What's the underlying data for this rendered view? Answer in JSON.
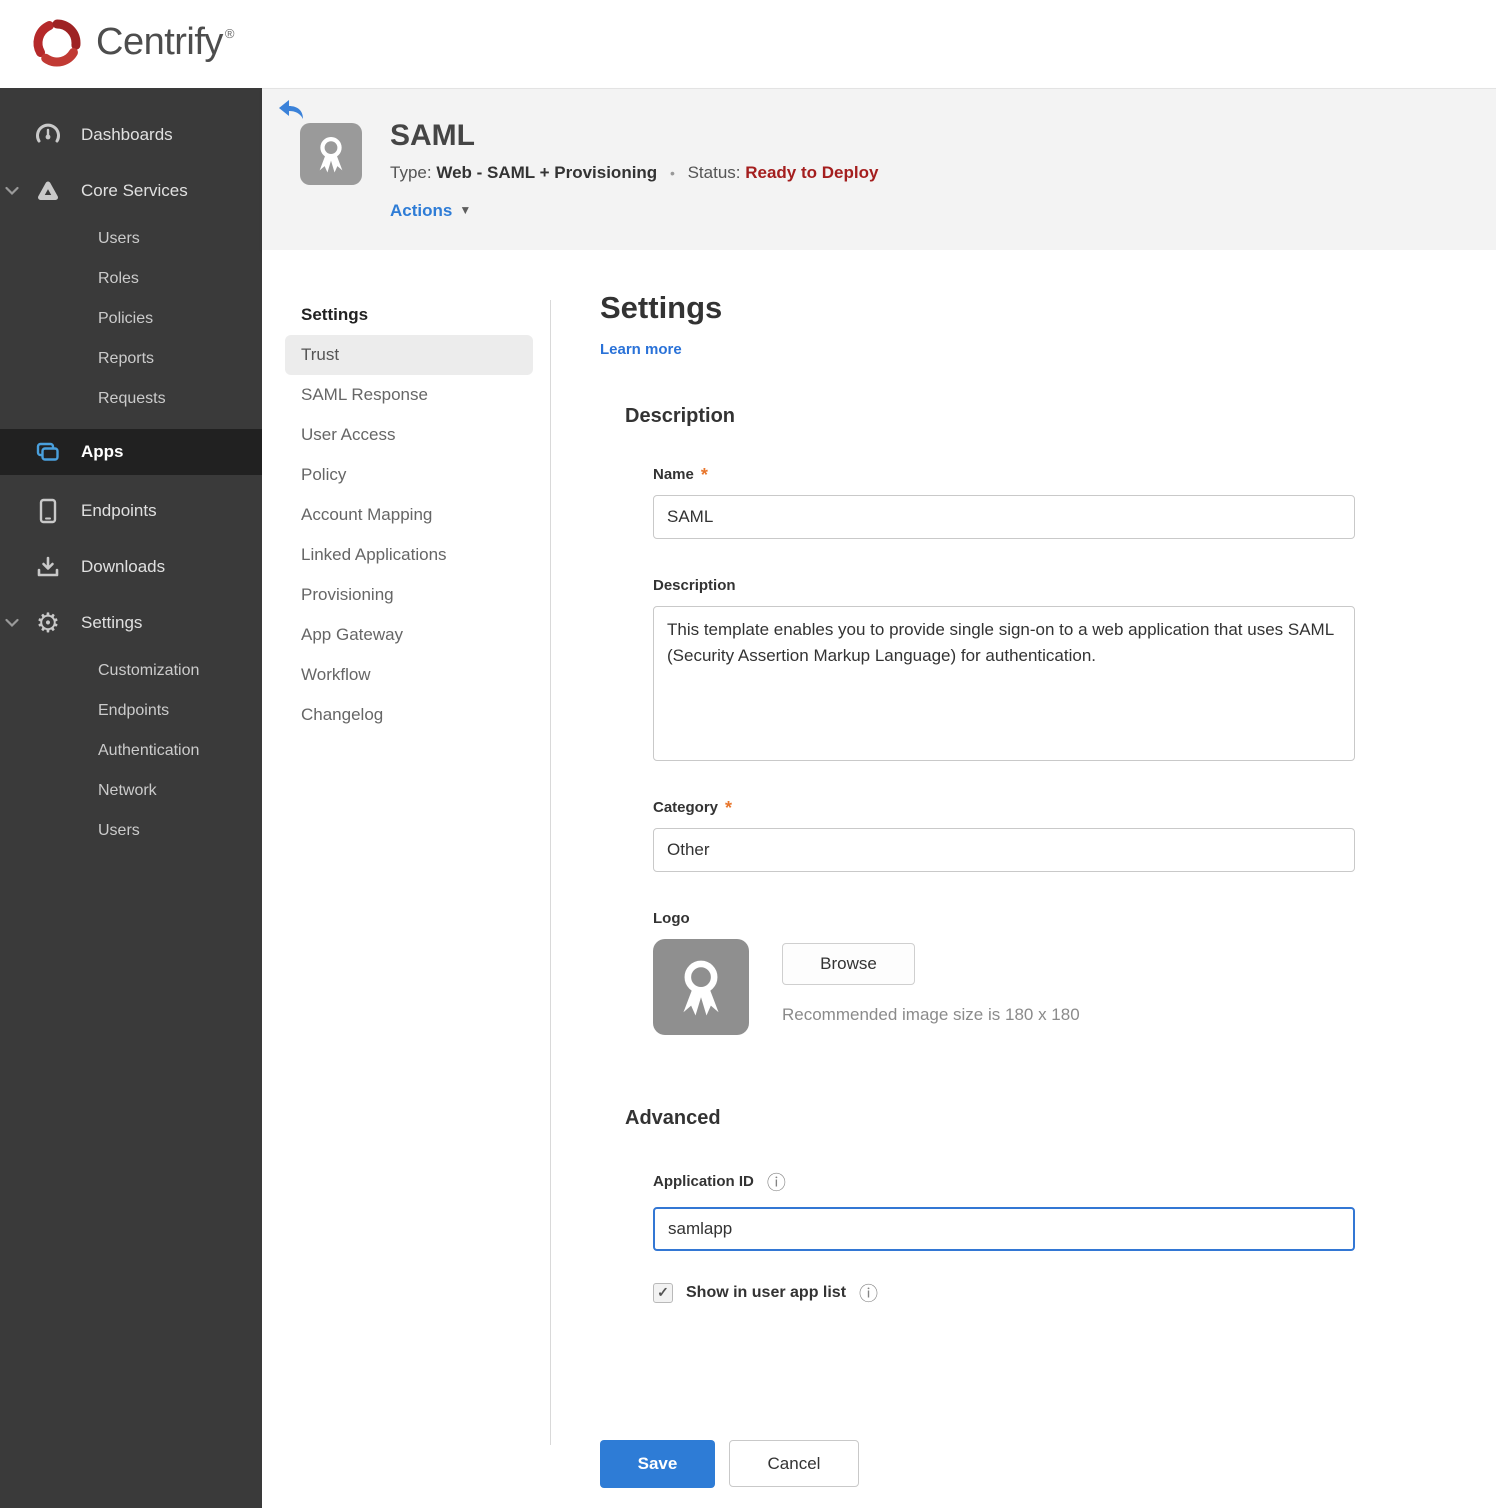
{
  "brand": {
    "name": "Centrify"
  },
  "icons": {
    "info": "ⓘ",
    "caret_down": "▼",
    "check": "✓",
    "required": "*",
    "registered": "®",
    "gear": "⚙"
  },
  "sidebar": {
    "items": [
      {
        "label": "Dashboards",
        "icon": "gauge-icon"
      },
      {
        "label": "Core Services",
        "icon": "core-services-icon",
        "expanded": true,
        "children": [
          "Users",
          "Roles",
          "Policies",
          "Reports",
          "Requests"
        ]
      },
      {
        "label": "Apps",
        "icon": "apps-icon",
        "active": true
      },
      {
        "label": "Endpoints",
        "icon": "device-icon"
      },
      {
        "label": "Downloads",
        "icon": "download-icon"
      },
      {
        "label": "Settings",
        "icon": "gear-icon",
        "expanded": true,
        "children": [
          "Customization",
          "Endpoints",
          "Authentication",
          "Network",
          "Users"
        ]
      }
    ]
  },
  "header": {
    "title": "SAML",
    "type_label": "Type:",
    "type_value": "Web - SAML + Provisioning",
    "separator": "•",
    "status_label": "Status:",
    "status_value": "Ready to Deploy",
    "actions_label": "Actions"
  },
  "subnav": {
    "heading": "Settings",
    "selected": "Trust",
    "items": [
      "Trust",
      "SAML Response",
      "User Access",
      "Policy",
      "Account Mapping",
      "Linked Applications",
      "Provisioning",
      "App Gateway",
      "Workflow",
      "Changelog"
    ]
  },
  "main": {
    "title": "Settings",
    "learn_more": "Learn more",
    "description_section": {
      "heading": "Description",
      "name_label": "Name",
      "name_value": "SAML",
      "description_label": "Description",
      "description_value": "This template enables you to provide single sign-on to a web application that uses SAML (Security Assertion Markup Language) for authentication.",
      "category_label": "Category",
      "category_value": "Other",
      "logo_label": "Logo",
      "browse_label": "Browse",
      "recommend_text": "Recommended image size is 180 x 180"
    },
    "advanced_section": {
      "heading": "Advanced",
      "app_id_label": "Application ID",
      "app_id_value": "samlapp",
      "show_in_list_label": "Show in user app list",
      "checkbox_checked": true
    }
  },
  "footer": {
    "save_label": "Save",
    "cancel_label": "Cancel"
  },
  "colors": {
    "accent_blue": "#2e7cd6",
    "status_red": "#a41e1e",
    "required_orange": "#e8762c",
    "sidebar_bg": "#3a3a3a",
    "sidebar_active_bg": "#212121",
    "brand_red": "#b5292a"
  }
}
